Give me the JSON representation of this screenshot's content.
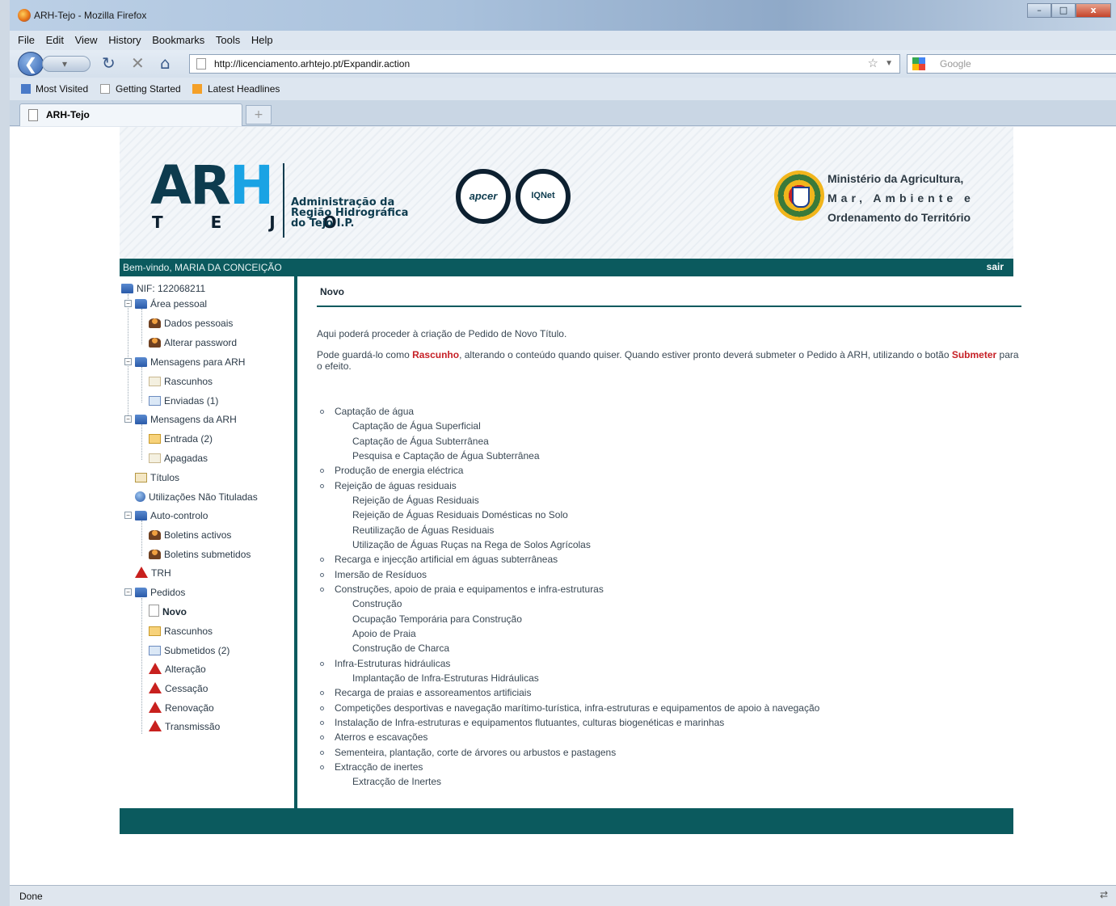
{
  "window": {
    "title": "ARH-Tejo - Mozilla Firefox",
    "controls": [
      "–",
      "□",
      "x"
    ]
  },
  "menu": [
    "File",
    "Edit",
    "View",
    "History",
    "Bookmarks",
    "Tools",
    "Help"
  ],
  "nav": {
    "url": "http://licenciamento.arhtejo.pt/Expandir.action",
    "search_placeholder": "Google"
  },
  "bookmarks": [
    "Most Visited",
    "Getting Started",
    "Latest Headlines"
  ],
  "tab": {
    "title": "ARH-Tejo",
    "new_tab": "+"
  },
  "banner": {
    "logo": "ARH",
    "logo_sub": "T E J O",
    "org": [
      "Administração da",
      "Região Hidrográfica",
      "do Tejo I.P."
    ],
    "seal1": "apcer",
    "seal2": "IQNet",
    "ministry": [
      "Ministério da Agricultura,",
      "Mar, Ambiente e",
      "Ordenamento do Território"
    ]
  },
  "welcome": {
    "text": "Bem-vindo, MARIA DA CONCEIÇÃO",
    "logout": "sair"
  },
  "sidebar": {
    "nif": "NIF: 122068211",
    "area_pessoal": "Área pessoal",
    "dados_pessoais": "Dados pessoais",
    "alterar_password": "Alterar password",
    "mensagens_para": "Mensagens para ARH",
    "rascunhos1": "Rascunhos",
    "enviadas": "Enviadas (1)",
    "mensagens_da": "Mensagens da ARH",
    "entrada": "Entrada (2)",
    "apagadas": "Apagadas",
    "titulos": "Títulos",
    "utilizacoes": "Utilizações Não Tituladas",
    "auto_controlo": "Auto-controlo",
    "boletins_activos": "Boletins activos",
    "boletins_submetidos": "Boletins submetidos",
    "trh": "TRH",
    "pedidos": "Pedidos",
    "novo": "Novo",
    "rascunhos2": "Rascunhos",
    "submetidos": "Submetidos (2)",
    "alteracao": "Alteração",
    "cessacao": "Cessação",
    "renovacao": "Renovação",
    "transmissao": "Transmissão"
  },
  "main": {
    "title": "Novo",
    "intro1": "Aqui poderá proceder à criação de Pedido de Novo Título.",
    "intro2_a": "Pode guardá-lo como ",
    "intro2_rascunho": "Rascunho",
    "intro2_b": ", alterando o conteúdo quando quiser. Quando estiver pronto deverá submeter o Pedido à ARH, utilizando o botão ",
    "intro2_submeter": "Submeter",
    "intro2_c": " para o efeito.",
    "items": [
      "Captação de água",
      "Captação de Água Superficial",
      "Captação de Água Subterrânea",
      "Pesquisa e Captação de Água Subterrânea",
      "Produção de energia eléctrica",
      "Rejeição de águas residuais",
      "Rejeição de Águas Residuais",
      "Rejeição de Águas Residuais Domésticas no Solo",
      "Reutilização de Águas Residuais",
      "Utilização de Águas Ruças na Rega de Solos Agrícolas",
      "Recarga e injecção artificial em águas subterrâneas",
      "Imersão de Resíduos",
      "Construções, apoio de praia e equipamentos e infra-estruturas",
      "Construção",
      "Ocupação Temporária para Construção",
      "Apoio de Praia",
      "Construção de Charca",
      "Infra-Estruturas hidráulicas",
      "Implantação de Infra-Estruturas Hidráulicas",
      "Recarga de praias e assoreamentos artificiais",
      "Competições desportivas e navegação marítimo-turística, infra-estruturas e equipamentos de apoio à navegação",
      "Instalação de Infra-estruturas e equipamentos flutuantes, culturas biogenéticas e marinhas",
      "Aterros e escavações",
      "Sementeira, plantação, corte de árvores ou arbustos e pastagens",
      "Extracção de inertes",
      "Extracção de Inertes"
    ]
  },
  "status": {
    "text": "Done"
  }
}
